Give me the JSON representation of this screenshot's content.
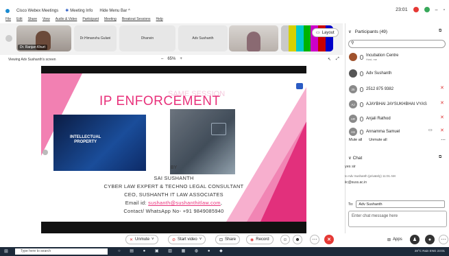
{
  "titlebar": {
    "app": "Cisco Webex Meetings",
    "meeting_info": "Meeting Info",
    "hide_menu": "Hide Menu Bar",
    "time": "23:01",
    "menu": [
      "File",
      "Edit",
      "Share",
      "View",
      "Audio & Video",
      "Participant",
      "Meeting",
      "Breakout Sessions",
      "Help"
    ]
  },
  "strip": {
    "self_name": "Dr. Ranjan Khurt",
    "tiles": [
      "Dr.Himanshu Gulani",
      "Dhanvin",
      "Adv Sushanth"
    ],
    "layout_label": "Layout"
  },
  "viewbar": {
    "label": "Viewing Adv Sushanth's screen",
    "zoom": "65%"
  },
  "slide": {
    "title": "IP ENFORCEMENT",
    "ghost": "SAME SESSION",
    "image_caption_1": "INTELLECTUAL",
    "image_caption_2": "PROPERTY",
    "by": "BY",
    "lines": [
      "SAI SUSHANTH",
      "CYBER LAW EXPERT & TECHNO LEGAL CONSULTANT",
      "CEO, SUSHANTH IT LAW ASSOCIATES"
    ],
    "email_prefix": "Email id: ",
    "email": "sushanth@sushanthitlaw.com",
    "email_suffix": ",",
    "contact": "Contact/ WhatsApp No- +91 9849085940"
  },
  "participants": {
    "title": "Participants (49)",
    "search_placeholder": "",
    "list": [
      {
        "name": "Incubation Centre",
        "sub": "Host, me",
        "initials": ""
      },
      {
        "name": "Adv Sushanth",
        "sub": "",
        "initials": ""
      },
      {
        "name": "2512 875 9382",
        "sub": "",
        "initials": "25"
      },
      {
        "name": "AJAYBHAI JAYSUKHBHAI VYAS",
        "sub": "",
        "initials": "AJ"
      },
      {
        "name": "Anjali Rathod",
        "sub": "",
        "initials": "AR"
      },
      {
        "name": "Annamma Samuel",
        "sub": "",
        "initials": "AS"
      }
    ],
    "mute_all": "Mute all",
    "unmute_all": "Unmute all"
  },
  "chat": {
    "title": "Chat",
    "msg1": "yes sir",
    "meta": "to Adv Sushanth (privately)   11:01 AM",
    "msg2": "iic@suss.ac.in",
    "to_label": "To:",
    "to_value": "Adv Sushanth",
    "input_placeholder": "Enter chat message here"
  },
  "controls": {
    "unmute": "Unmute",
    "start_video": "Start video",
    "share": "Share",
    "record": "Record",
    "apps": "Apps"
  },
  "taskbar": {
    "search": "Type here to search",
    "tray": "28°C Rain  ENG  23:01"
  },
  "colors": {
    "accent_pink": "#e8307a",
    "leave_red": "#e53935",
    "webex_blue": "#2b5cc4"
  }
}
